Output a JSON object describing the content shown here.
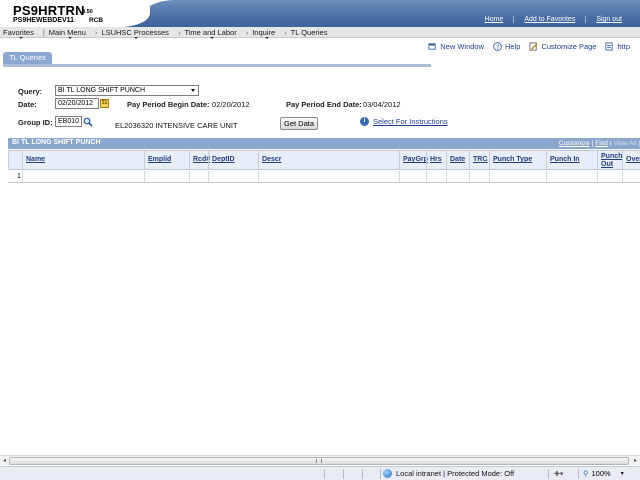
{
  "header": {
    "system_name": "PS9HRTRN",
    "system_version": "8.50",
    "database": "PS9HEWEBDEV11",
    "user": "RCB",
    "links": [
      "Home",
      "Add to Favorites",
      "Sign out"
    ]
  },
  "menu": {
    "items": [
      "Favorites",
      "Main Menu",
      "LSUHSC Processes",
      "Time and Labor",
      "Inquire",
      "TL Queries"
    ]
  },
  "toolbar": {
    "new_window": "New Window",
    "help": "Help",
    "customize_page": "Customize Page",
    "http": "http"
  },
  "tab": {
    "label": "TL Queries"
  },
  "form": {
    "query_label": "Query:",
    "query_value": "BI TL LONG SHIFT PUNCH",
    "date_label": "Date:",
    "date_value": "02/20/2012",
    "calendar_glyph": "31",
    "pp_begin_label": "Pay Period Begin Date:",
    "pp_begin_value": "02/20/2012",
    "pp_end_label": "Pay Period End Date:",
    "pp_end_value": "03/04/2012",
    "group_label": "Group ID:",
    "group_value": "EB010",
    "group_desc": "EL2036320 INTENSIVE CARE UNIT",
    "get_data": "Get Data",
    "info_glyph": "i",
    "instructions": "Select For Instructions"
  },
  "grid": {
    "title": "BI TL LONG SHIFT PUNCH",
    "nav": {
      "customize": "Customize",
      "sep": "|",
      "find": "Find",
      "view_all": "View All",
      "sep2": "|"
    },
    "columns": [
      "Name",
      "Emplid",
      "Rcd#",
      "DeptID",
      "Descr",
      "PayGrp",
      "Hrs",
      "Date",
      "TRC",
      "Punch Type",
      "Punch In",
      "Punch Out",
      "Over"
    ],
    "rows": [
      {
        "num": "1"
      }
    ]
  },
  "statusbar": {
    "zone": "Local intranet | Protected Mode: Off",
    "zoom": "100%"
  },
  "colors": {
    "header_blue": "#3d67a7",
    "grid_header": "#8aa6cc",
    "tab": "#89a7d0",
    "link": "#1f3f8f"
  }
}
